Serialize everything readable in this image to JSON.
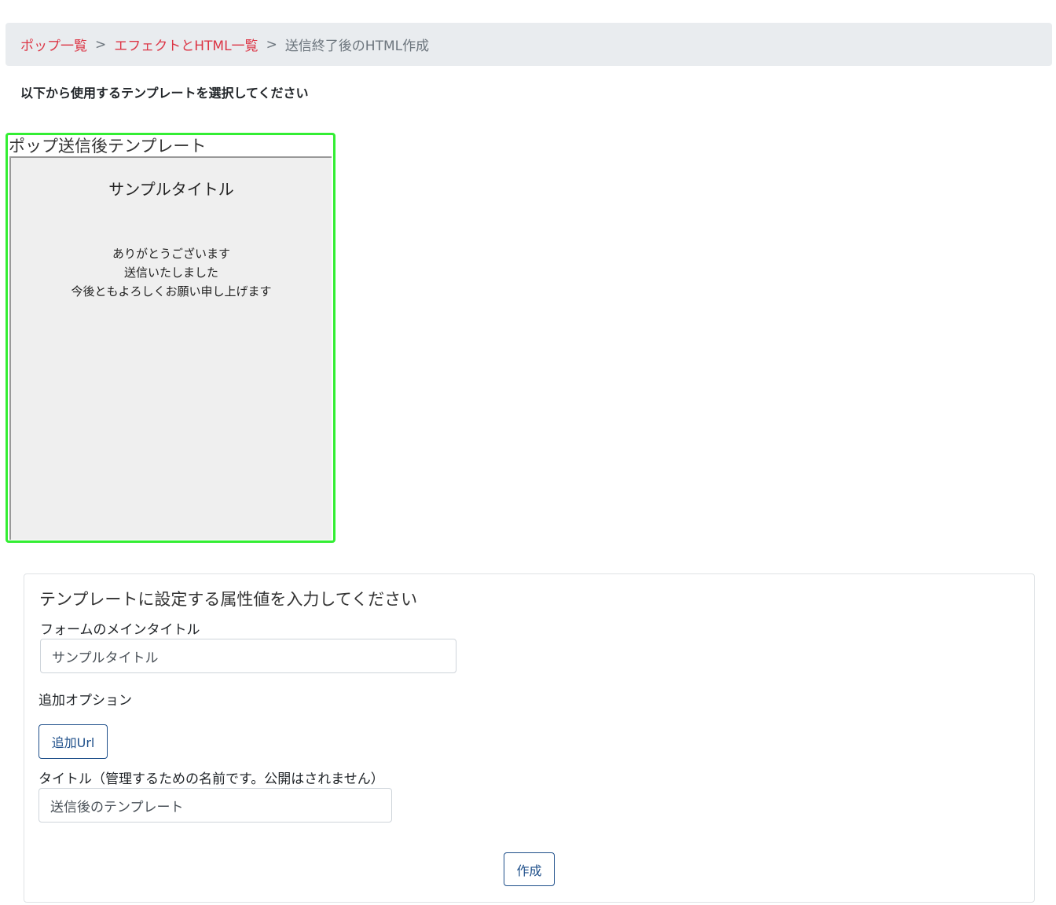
{
  "breadcrumb": {
    "items": [
      {
        "label": "ポップ一覧"
      },
      {
        "label": "エフェクトとHTML一覧"
      }
    ],
    "separator": ">",
    "current": "送信終了後のHTML作成",
    "link_color": "#dc3545"
  },
  "instruction": "以下から使用するテンプレートを選択してください",
  "template": {
    "title": "ポップ送信後テンプレート",
    "selected_border_color": "#33ee33",
    "preview": {
      "title": "サンプルタイトル",
      "lines": [
        "ありがとうございます",
        "送信いたしました",
        "今後ともよろしくお願い申し上げます"
      ]
    }
  },
  "form": {
    "heading": "テンプレートに設定する属性値を入力してください",
    "main_title_label": "フォームのメインタイトル",
    "main_title_value": "サンプルタイトル",
    "options_label": "追加オプション",
    "add_url_button": "追加Url",
    "title_label": "タイトル（管理するための名前です。公開はされません）",
    "title_value": "送信後のテンプレート",
    "create_button": "作成"
  }
}
